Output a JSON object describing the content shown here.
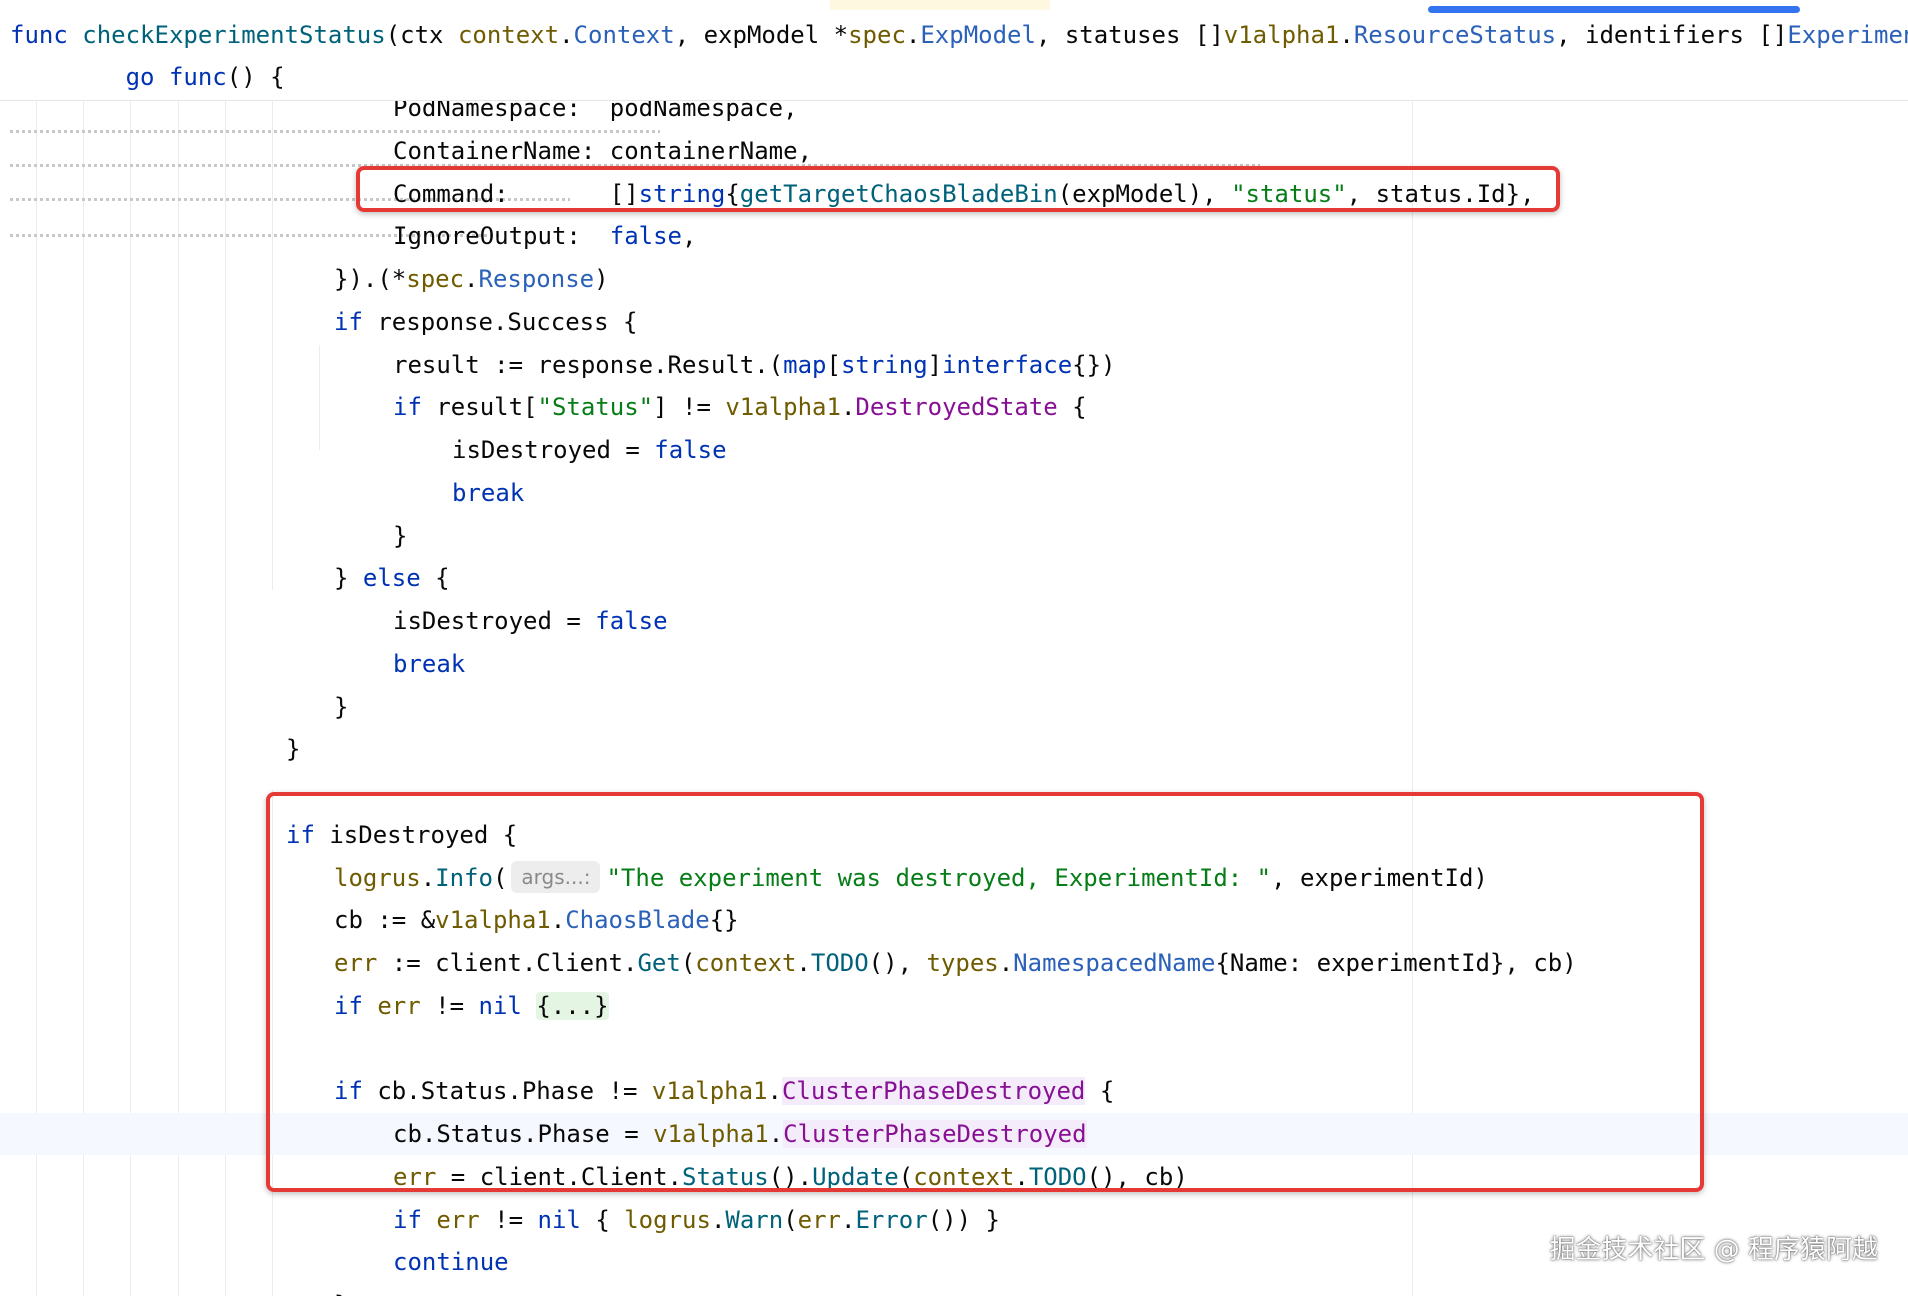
{
  "sticky_header": {
    "line1": [
      {
        "t": "func",
        "c": "kw"
      },
      {
        "t": " "
      },
      {
        "t": "checkExperimentStatus",
        "c": "fn"
      },
      {
        "t": "(ctx "
      },
      {
        "t": "context",
        "c": "pkg"
      },
      {
        "t": "."
      },
      {
        "t": "Context",
        "c": "ty"
      },
      {
        "t": ", expModel *"
      },
      {
        "t": "spec",
        "c": "pkg"
      },
      {
        "t": "."
      },
      {
        "t": "ExpModel",
        "c": "ty"
      },
      {
        "t": ", statuses []"
      },
      {
        "t": "v1alpha1",
        "c": "pkg"
      },
      {
        "t": "."
      },
      {
        "t": "ResourceStatus",
        "c": "ty"
      },
      {
        "t": ", identifiers []"
      },
      {
        "t": "Experimen",
        "c": "ty"
      }
    ],
    "line2": [
      {
        "t": "        "
      },
      {
        "t": "go",
        "c": "kw"
      },
      {
        "t": " "
      },
      {
        "t": "func",
        "c": "kw"
      },
      {
        "t": "() {"
      }
    ]
  },
  "code_lines": [
    [
      {
        "t": "PodNamespace:  podNamespace,"
      }
    ],
    [
      {
        "t": "ContainerName: containerName,"
      }
    ],
    [
      {
        "t": "Command:       []"
      },
      {
        "t": "string",
        "c": "kw"
      },
      {
        "t": "{"
      },
      {
        "t": "getTargetChaosBladeBin",
        "c": "fn"
      },
      {
        "t": "(expModel), "
      },
      {
        "t": "\"status\"",
        "c": "str"
      },
      {
        "t": ", status.Id},"
      }
    ],
    [
      {
        "t": "IgnoreOutput:  "
      },
      {
        "t": "false",
        "c": "kw"
      },
      {
        "t": ","
      }
    ],
    [
      {
        "t": "}).(*"
      },
      {
        "t": "spec",
        "c": "pkg"
      },
      {
        "t": "."
      },
      {
        "t": "Response",
        "c": "ty"
      },
      {
        "t": ")"
      }
    ],
    [
      {
        "t": "if",
        "c": "kw"
      },
      {
        "t": " response.Success {"
      }
    ],
    [
      {
        "t": "result := response.Result.("
      },
      {
        "t": "map",
        "c": "kw"
      },
      {
        "t": "["
      },
      {
        "t": "string",
        "c": "kw"
      },
      {
        "t": "]"
      },
      {
        "t": "interface",
        "c": "kw"
      },
      {
        "t": "{})"
      }
    ],
    [
      {
        "t": "if",
        "c": "kw"
      },
      {
        "t": " result["
      },
      {
        "t": "\"Status\"",
        "c": "str"
      },
      {
        "t": "] != "
      },
      {
        "t": "v1alpha1",
        "c": "pkg"
      },
      {
        "t": "."
      },
      {
        "t": "DestroyedState",
        "c": "cst"
      },
      {
        "t": " {"
      }
    ],
    [
      {
        "t": "isDestroyed = "
      },
      {
        "t": "false",
        "c": "kw"
      }
    ],
    [
      {
        "t": "break",
        "c": "kw"
      }
    ],
    [
      {
        "t": "}"
      }
    ],
    [
      {
        "t": "} "
      },
      {
        "t": "else",
        "c": "kw"
      },
      {
        "t": " {"
      }
    ],
    [
      {
        "t": "isDestroyed = "
      },
      {
        "t": "false",
        "c": "kw"
      }
    ],
    [
      {
        "t": "break",
        "c": "kw"
      }
    ],
    [
      {
        "t": "}"
      }
    ],
    [
      {
        "t": "}"
      }
    ],
    [],
    [
      {
        "t": "if",
        "c": "kw"
      },
      {
        "t": " isDestroyed {"
      }
    ],
    [
      {
        "t": "logrus",
        "c": "pkg"
      },
      {
        "t": "."
      },
      {
        "t": "Info",
        "c": "fn"
      },
      {
        "t": "("
      },
      {
        "hint": "args...:"
      },
      {
        "t": "\"The experiment was destroyed, ExperimentId: \"",
        "c": "str"
      },
      {
        "t": ", experimentId)"
      }
    ],
    [
      {
        "t": "cb := &"
      },
      {
        "t": "v1alpha1",
        "c": "pkg"
      },
      {
        "t": "."
      },
      {
        "t": "ChaosBlade",
        "c": "ty"
      },
      {
        "t": "{}"
      }
    ],
    [
      {
        "t": "err",
        "c": "pkg"
      },
      {
        "t": " := client.Client."
      },
      {
        "t": "Get",
        "c": "fn"
      },
      {
        "t": "("
      },
      {
        "t": "context",
        "c": "pkg"
      },
      {
        "t": "."
      },
      {
        "t": "TODO",
        "c": "fn"
      },
      {
        "t": "(), "
      },
      {
        "t": "types",
        "c": "pkg"
      },
      {
        "t": "."
      },
      {
        "t": "NamespacedName",
        "c": "ty"
      },
      {
        "t": "{Name: experimentId}, cb)"
      }
    ],
    [
      {
        "t": "if",
        "c": "kw"
      },
      {
        "t": " "
      },
      {
        "t": "err",
        "c": "pkg"
      },
      {
        "t": " != "
      },
      {
        "t": "nil",
        "c": "kw"
      },
      {
        "t": " "
      },
      {
        "t": "{...}",
        "c": "fold"
      }
    ],
    [],
    [
      {
        "t": "if",
        "c": "kw"
      },
      {
        "t": " cb.Status.Phase != "
      },
      {
        "t": "v1alpha1",
        "c": "pkg"
      },
      {
        "t": "."
      },
      {
        "t": "ClusterPhaseDestroyed",
        "c": "cst-bg"
      },
      {
        "t": " {"
      }
    ],
    [
      {
        "t": "cb.Status.Phase = "
      },
      {
        "t": "v1alpha1",
        "c": "pkg"
      },
      {
        "t": "."
      },
      {
        "t": "ClusterPhaseDestroyed",
        "c": "cst-bg"
      }
    ],
    [
      {
        "t": "err",
        "c": "pkg"
      },
      {
        "t": " = client.Client."
      },
      {
        "t": "Status",
        "c": "fn"
      },
      {
        "t": "()."
      },
      {
        "t": "Update",
        "c": "fn"
      },
      {
        "t": "("
      },
      {
        "t": "context",
        "c": "pkg"
      },
      {
        "t": "."
      },
      {
        "t": "TODO",
        "c": "fn"
      },
      {
        "t": "(), cb)"
      }
    ],
    [
      {
        "t": "if",
        "c": "kw"
      },
      {
        "t": " "
      },
      {
        "t": "err",
        "c": "pkg"
      },
      {
        "t": " != "
      },
      {
        "t": "nil",
        "c": "kw"
      },
      {
        "t": " { "
      },
      {
        "t": "logrus",
        "c": "pkg"
      },
      {
        "t": "."
      },
      {
        "t": "Warn",
        "c": "fn"
      },
      {
        "t": "("
      },
      {
        "t": "err",
        "c": "pkg"
      },
      {
        "t": "."
      },
      {
        "t": "Error",
        "c": "fn"
      },
      {
        "t": "()) }"
      }
    ],
    [
      {
        "t": "continue",
        "c": "kw"
      }
    ],
    [
      {
        "t": "}"
      }
    ]
  ],
  "watermark": "掘金技术社区 @ 程序猿阿越"
}
